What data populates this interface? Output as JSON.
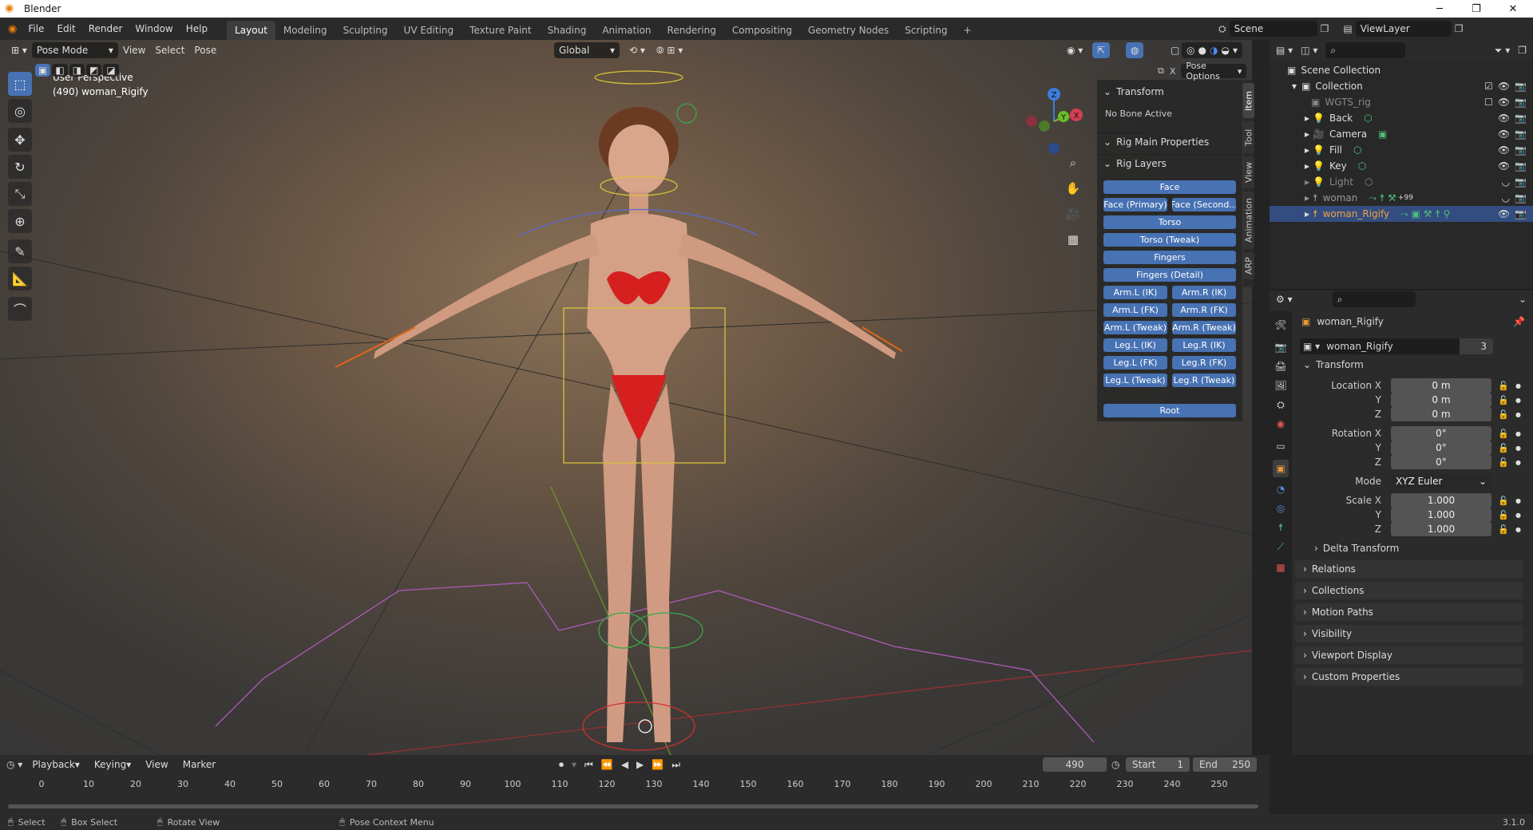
{
  "window": {
    "title": "Blender",
    "min": "─",
    "max": "❐",
    "close": "✕"
  },
  "topbar": {
    "menus": [
      "File",
      "Edit",
      "Render",
      "Window",
      "Help"
    ],
    "workspaces": [
      "Layout",
      "Modeling",
      "Sculpting",
      "UV Editing",
      "Texture Paint",
      "Shading",
      "Animation",
      "Rendering",
      "Compositing",
      "Geometry Nodes",
      "Scripting"
    ],
    "active_workspace": "Layout",
    "add_tab": "+",
    "scene": "Scene",
    "view_layer": "ViewLayer"
  },
  "viewport": {
    "mode": "Pose Mode",
    "menus": [
      "View",
      "Select",
      "Pose"
    ],
    "orientation": "Global",
    "perspective_label": "User Perspective",
    "object_label": "(490) woman_Rigify",
    "pose_options": "Pose Options",
    "gizmo": {
      "x": "X",
      "y": "Y",
      "z": "Z"
    }
  },
  "npanel": {
    "transform_header": "Transform",
    "no_bone": "No Bone Active",
    "rig_main": "Rig Main Properties",
    "rig_layers": "Rig Layers",
    "buttons": {
      "face": "Face",
      "face_primary": "Face (Primary)",
      "face_secondary": "Face (Second...",
      "torso": "Torso",
      "torso_tweak": "Torso (Tweak)",
      "fingers": "Fingers",
      "fingers_detail": "Fingers (Detail)",
      "arm_l_ik": "Arm.L (IK)",
      "arm_r_ik": "Arm.R (IK)",
      "arm_l_fk": "Arm.L (FK)",
      "arm_r_fk": "Arm.R (FK)",
      "arm_l_tweak": "Arm.L (Tweak)",
      "arm_r_tweak": "Arm.R (Tweak)",
      "leg_l_ik": "Leg.L (IK)",
      "leg_r_ik": "Leg.R (IK)",
      "leg_l_fk": "Leg.L (FK)",
      "leg_r_fk": "Leg.R (FK)",
      "leg_l_tweak": "Leg.L (Tweak)",
      "leg_r_tweak": "Leg.R (Tweak)",
      "root": "Root"
    },
    "tabs": [
      "Item",
      "Tool",
      "View",
      "Animation",
      "ARP"
    ]
  },
  "outliner": {
    "scene_collection": "Scene Collection",
    "collection": "Collection",
    "items": [
      "WGTS_rig",
      "Back",
      "Camera",
      "Fill",
      "Key",
      "Light",
      "woman",
      "woman_Rigify"
    ],
    "badge": "+99"
  },
  "properties": {
    "object_name": "woman_Rigify",
    "data_name": "woman_Rigify",
    "users": "3",
    "transform": "Transform",
    "location_x_label": "Location X",
    "rotation_x_label": "Rotation X",
    "scale_x_label": "Scale X",
    "y_label": "Y",
    "z_label": "Z",
    "mode_label": "Mode",
    "loc": [
      "0 m",
      "0 m",
      "0 m"
    ],
    "rot": [
      "0°",
      "0°",
      "0°"
    ],
    "mode": "XYZ Euler",
    "scale": [
      "1.000",
      "1.000",
      "1.000"
    ],
    "delta": "Delta Transform",
    "sections": [
      "Relations",
      "Collections",
      "Motion Paths",
      "Visibility",
      "Viewport Display",
      "Custom Properties"
    ]
  },
  "timeline": {
    "menus": [
      "Playback",
      "Keying",
      "View",
      "Marker"
    ],
    "current_frame": "490",
    "start_label": "Start",
    "start": "1",
    "end_label": "End",
    "end": "250",
    "ticks": [
      "0",
      "10",
      "20",
      "30",
      "40",
      "50",
      "60",
      "70",
      "80",
      "90",
      "100",
      "110",
      "120",
      "130",
      "140",
      "150",
      "160",
      "170",
      "180",
      "190",
      "200",
      "210",
      "220",
      "230",
      "240",
      "250"
    ]
  },
  "status": {
    "select": "Select",
    "box_select": "Box Select",
    "rotate": "Rotate View",
    "context": "Pose Context Menu",
    "version": "3.1.0"
  }
}
